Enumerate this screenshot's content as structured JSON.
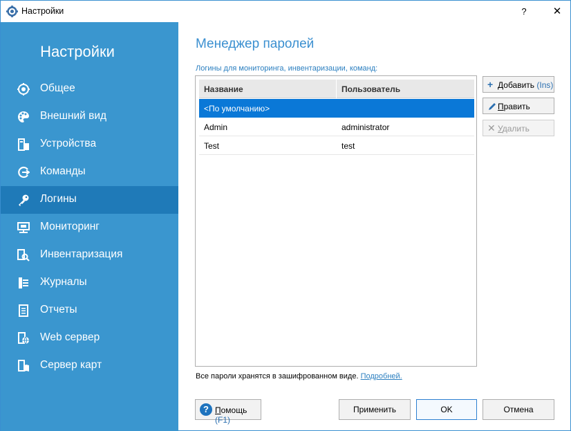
{
  "window": {
    "title": "Настройки",
    "help_glyph": "?",
    "close_glyph": "✕"
  },
  "sidebar": {
    "title": "Настройки",
    "items": [
      {
        "label": "Общее",
        "icon": "gear-icon"
      },
      {
        "label": "Внешний вид",
        "icon": "palette-icon"
      },
      {
        "label": "Устройства",
        "icon": "devices-icon"
      },
      {
        "label": "Команды",
        "icon": "commands-icon"
      },
      {
        "label": "Логины",
        "icon": "key-icon",
        "active": true
      },
      {
        "label": "Мониторинг",
        "icon": "monitor-icon"
      },
      {
        "label": "Инвентаризация",
        "icon": "inventory-search-icon"
      },
      {
        "label": "Журналы",
        "icon": "journals-icon"
      },
      {
        "label": "Отчеты",
        "icon": "reports-icon"
      },
      {
        "label": "Web сервер",
        "icon": "web-server-icon"
      },
      {
        "label": "Сервер карт",
        "icon": "map-server-icon"
      }
    ]
  },
  "main": {
    "title": "Менеджер паролей",
    "subtitle": "Логины для мониторинга, инвентаризации, команд:",
    "table": {
      "columns": [
        "Название",
        "Пользователь"
      ],
      "rows": [
        {
          "name": "<По умолчанию>",
          "user": "",
          "selected": true
        },
        {
          "name": "Admin",
          "user": "administrator"
        },
        {
          "name": "Test",
          "user": "test"
        }
      ]
    },
    "footer_note": "Все пароли хранятся в зашифрованном виде.",
    "footer_link": "Подробней."
  },
  "buttons": {
    "add_hot": "Д",
    "add_rest": "обавить",
    "add_key": "(Ins)",
    "edit_hot": "П",
    "edit_rest": "равить",
    "delete_hot": "У",
    "delete_rest": "далить",
    "help_hot": "П",
    "help_rest": "омощь",
    "help_key": "(F1)",
    "apply": "Применить",
    "ok": "OK",
    "cancel": "Отмена"
  },
  "colors": {
    "sidebar_bg": "#3a96cf",
    "sidebar_active": "#1f7ab8",
    "accent": "#3a8fd0",
    "selection": "#0a78d7"
  }
}
